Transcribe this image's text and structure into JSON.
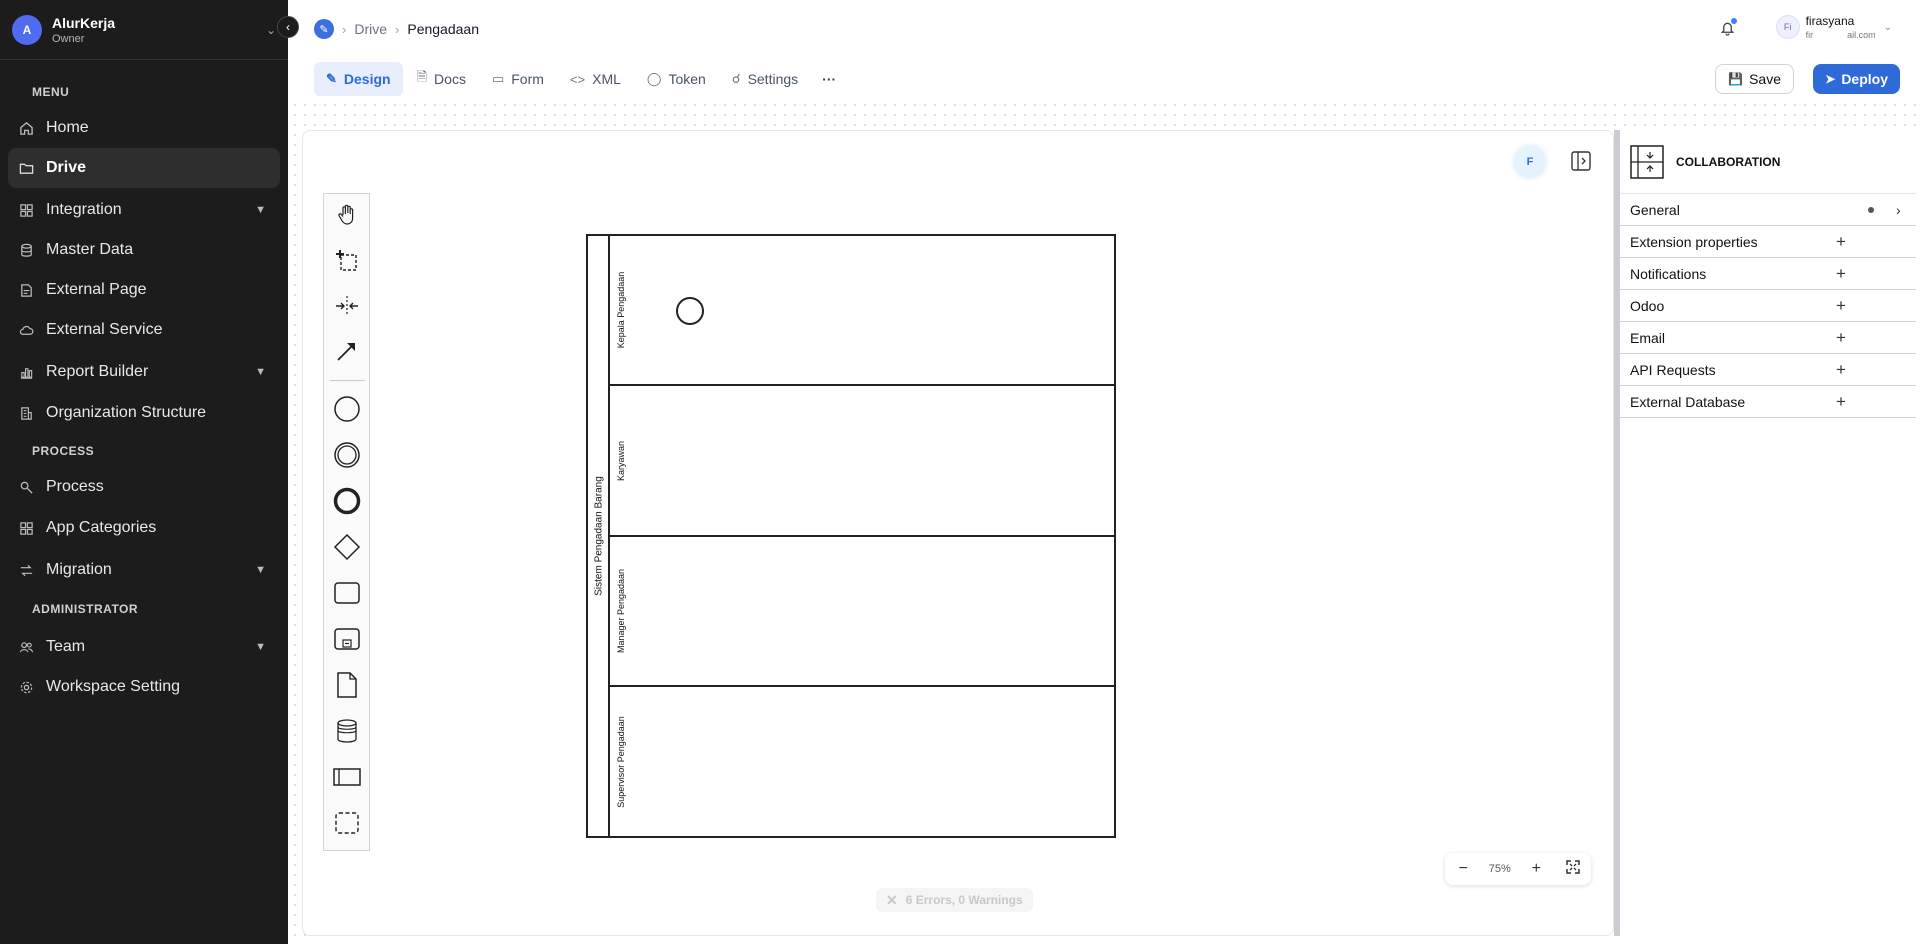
{
  "workspace": {
    "avatar": "A",
    "name": "AlurKerja",
    "role": "Owner"
  },
  "sidebar": {
    "sections": {
      "menu": "MENU",
      "process": "PROCESS",
      "admin": "ADMINISTRATOR"
    },
    "items": [
      {
        "label": "Home",
        "icon": "home-icon"
      },
      {
        "label": "Drive",
        "icon": "folder-icon",
        "active": true
      },
      {
        "label": "Integration",
        "icon": "grid-icon",
        "expandable": true
      },
      {
        "label": "Master Data",
        "icon": "database-icon"
      },
      {
        "label": "External Page",
        "icon": "page-icon"
      },
      {
        "label": "External Service",
        "icon": "cloud-icon"
      },
      {
        "label": "Report Builder",
        "icon": "chart-icon",
        "expandable": true
      },
      {
        "label": "Organization Structure",
        "icon": "building-icon"
      },
      {
        "label": "Process",
        "icon": "process-icon"
      },
      {
        "label": "App Categories",
        "icon": "grid-icon"
      },
      {
        "label": "Migration",
        "icon": "migration-icon",
        "expandable": true
      },
      {
        "label": "Team",
        "icon": "team-icon",
        "expandable": true
      },
      {
        "label": "Workspace Setting",
        "icon": "gear-icon"
      }
    ]
  },
  "breadcrumb": {
    "root": "Drive",
    "current": "Pengadaan"
  },
  "user": {
    "avatar": "Fi",
    "name": "firasyana",
    "email_left": "fir",
    "email_right": "ail.com"
  },
  "tabs": [
    {
      "label": "Design",
      "icon": "pen-icon",
      "active": true
    },
    {
      "label": "Docs",
      "icon": "doc-icon"
    },
    {
      "label": "Form",
      "icon": "form-icon"
    },
    {
      "label": "XML",
      "icon": "code-icon"
    },
    {
      "label": "Token",
      "icon": "token-icon"
    },
    {
      "label": "Settings",
      "icon": "paint-roller-icon"
    }
  ],
  "tabs_more": "···",
  "actions": {
    "save": "Save",
    "deploy": "Deploy"
  },
  "colors": {
    "accent": "#2f6bd8",
    "sidebar_bg": "#1c1c1c"
  },
  "diagram": {
    "pool": "Sistem Pengadaan Barang",
    "lanes": [
      "Kepala Pengadaan",
      "Karyawan",
      "Manager Pengadaan",
      "Supervisor Pengadaan"
    ]
  },
  "presence": {
    "initial": "F"
  },
  "zoom": {
    "minus": "−",
    "value": "75%",
    "plus": "+"
  },
  "status": {
    "errors": "6 Errors, 0 Warnings"
  },
  "properties": {
    "title": "COLLABORATION",
    "groups": [
      "General",
      "Extension properties",
      "Notifications",
      "Odoo",
      "Email",
      "API Requests",
      "External Database"
    ]
  }
}
